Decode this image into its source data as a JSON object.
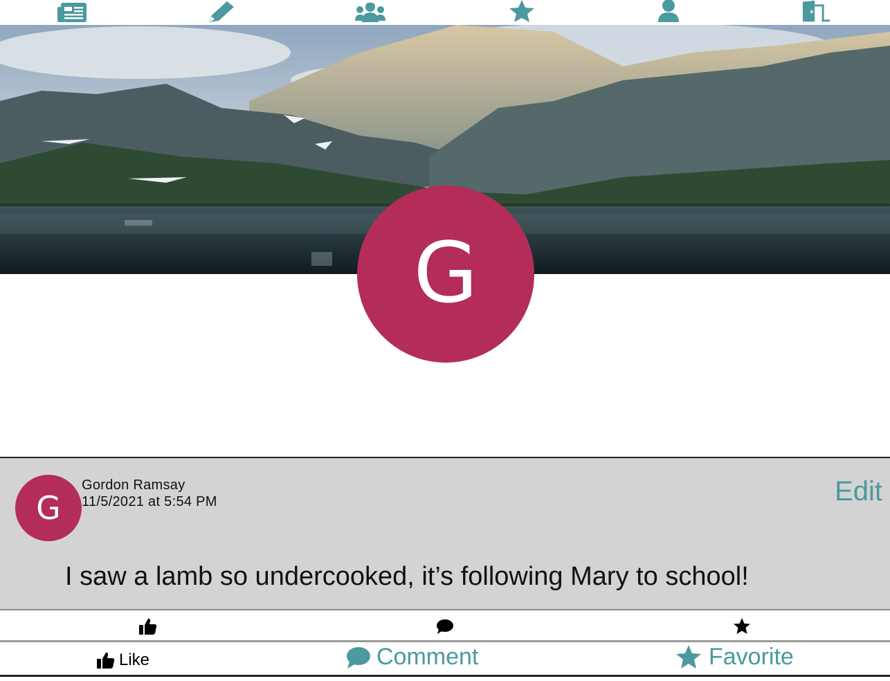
{
  "nav": {
    "items": [
      {
        "icon": "newspaper-icon"
      },
      {
        "icon": "pencil-icon"
      },
      {
        "icon": "users-icon"
      },
      {
        "icon": "star-icon"
      },
      {
        "icon": "user-icon"
      },
      {
        "icon": "door-open-icon"
      }
    ],
    "color": "#4a9a9e"
  },
  "profile": {
    "initial": "G",
    "avatar_color": "#b32d58"
  },
  "post": {
    "avatar_initial": "G",
    "author": "Gordon Ramsay",
    "timestamp": "11/5/2021 at 5:54 PM",
    "edit_label": "Edit",
    "body": "I saw a lamb so undercooked, it’s following Mary to school!"
  },
  "stats_row": {
    "icons": [
      "thumbs-up-icon",
      "comment-icon",
      "star-icon"
    ]
  },
  "actions": {
    "like_label": "Like",
    "comment_label": "Comment",
    "favorite_label": "Favorite"
  },
  "colors": {
    "accent": "#4a9a9e",
    "avatar": "#b32d58",
    "post_background": "#d3d3d3"
  }
}
